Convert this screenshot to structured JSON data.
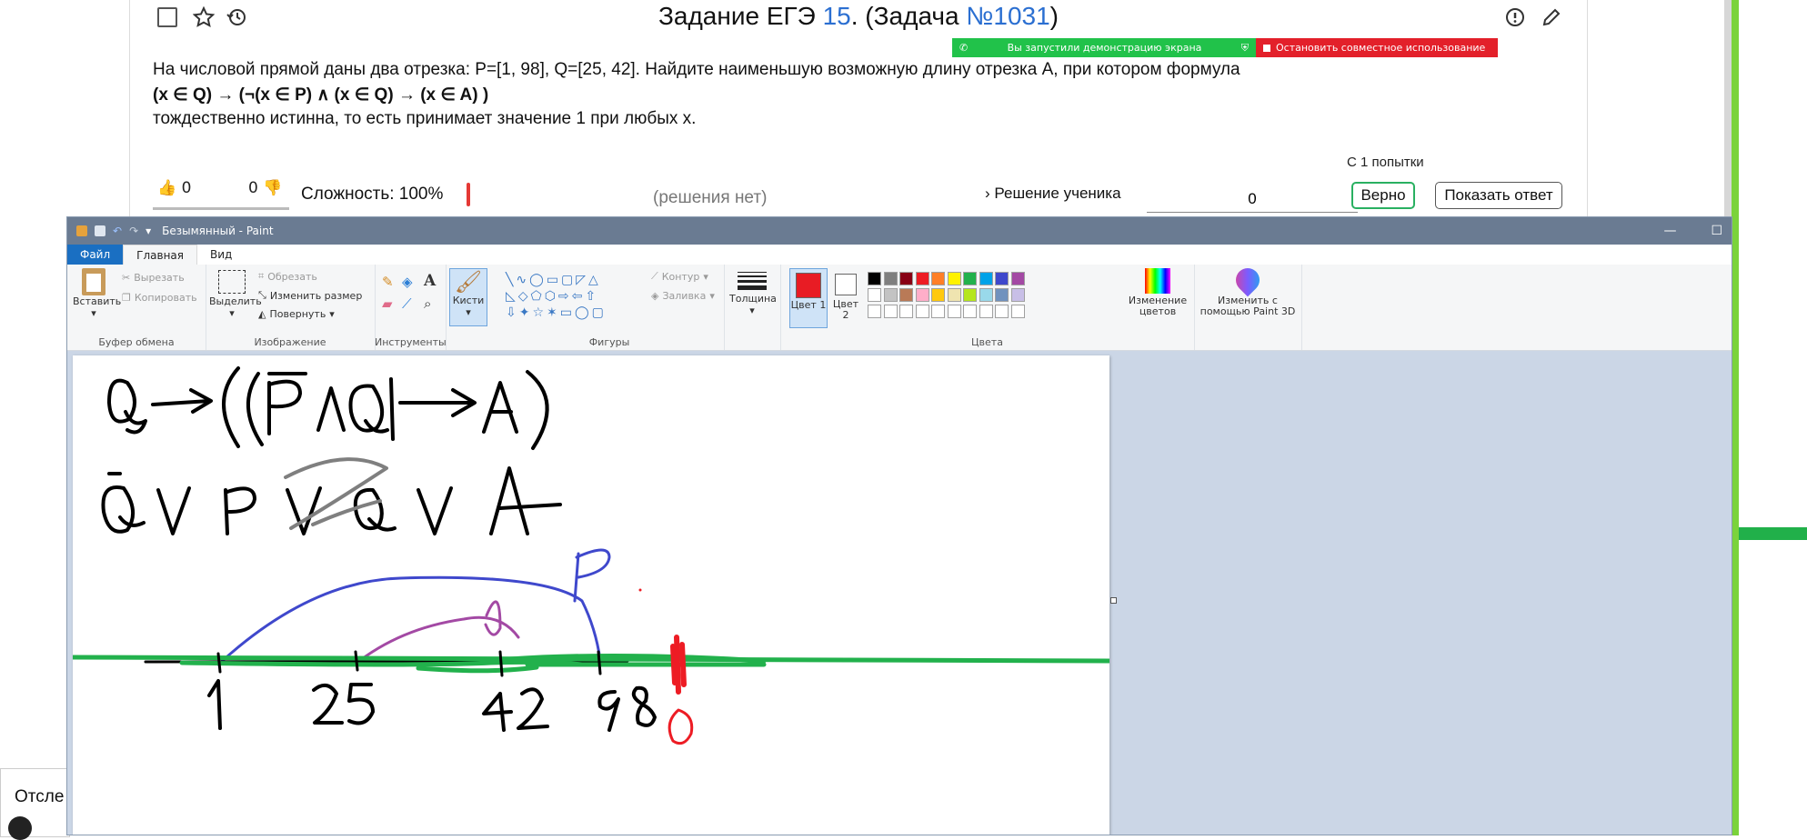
{
  "task": {
    "title_prefix": "Задание ЕГЭ ",
    "title_number": "15",
    "title_mid": ". (Задача ",
    "title_task_id": "№1031",
    "title_suffix": ")",
    "line1": "На числовой прямой даны два отрезка: P=[1, 98], Q=[25, 42]. Найдите наименьшую возможную длину отрезка A, при котором формула",
    "formula": "(x ∈ Q) → (¬(x ∈ P) ∧ (x ∈ Q) → (x ∈ A) )",
    "line3": "тождественно истинна, то есть принимает значение 1 при любых x.",
    "likes": "0",
    "dislikes": "0",
    "difficulty": "Сложность: 100%",
    "no_solution": "(решения нет)",
    "attempts": "С 1 попытки",
    "student_solution": "Решение ученика",
    "answer_value": "0",
    "correct_button": "Верно",
    "show_answer_button": "Показать ответ"
  },
  "share_bar": {
    "demo_text": "Вы запустили демонстрацию экрана",
    "stop_text": "Остановить совместное использование",
    "green": "#21c24a",
    "red": "#e3202a"
  },
  "tracking": {
    "text": "Отсле"
  },
  "paint": {
    "window_title": "Безымянный - Paint",
    "tabs": [
      "Файл",
      "Главная",
      "Вид"
    ],
    "clipboard": {
      "paste": "Вставить",
      "cut": "Вырезать",
      "copy": "Копировать",
      "label": "Буфер обмена"
    },
    "image": {
      "select": "Выделить",
      "crop": "Обрезать",
      "resize": "Изменить размер",
      "rotate": "Повернуть",
      "label": "Изображение"
    },
    "tools": {
      "label": "Инструменты"
    },
    "brushes": {
      "label": "Кисти"
    },
    "shapes": {
      "outline": "Контур",
      "fill": "Заливка",
      "label": "Фигуры"
    },
    "thickness": {
      "label": "Толщина"
    },
    "colors": {
      "color1": "Цвет 1",
      "color2": "Цвет 2",
      "edit": "Изменение цветов",
      "paint3d": "Изменить с помощью Paint 3D",
      "label": "Цвета",
      "color1_value": "#e81c24",
      "palette_row1": [
        "#000000",
        "#7f7f7f",
        "#880015",
        "#ed1c24",
        "#ff7f27",
        "#fff200",
        "#22b14c",
        "#00a2e8",
        "#3f48cc",
        "#a349a4"
      ],
      "palette_row2": [
        "#ffffff",
        "#c3c3c3",
        "#b97a57",
        "#ffaec9",
        "#ffc90e",
        "#efe4b0",
        "#b5e61d",
        "#99d9ea",
        "#7092be",
        "#c8bfe7"
      ]
    }
  }
}
